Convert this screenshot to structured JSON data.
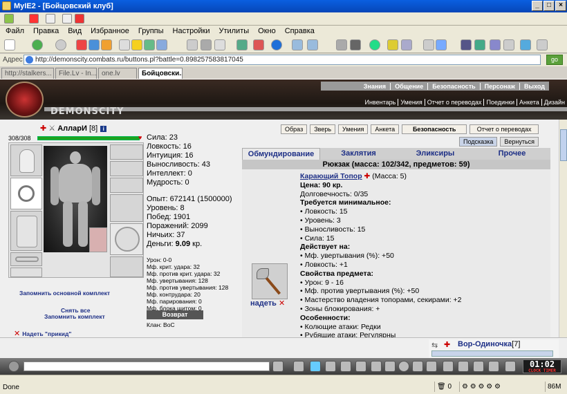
{
  "window": {
    "title": "MyIE2 - [Бойцовский клуб]"
  },
  "menu": [
    "Файл",
    "Правка",
    "Вид",
    "Избранное",
    "Группы",
    "Настройки",
    "Утилиты",
    "Окно",
    "Справка"
  ],
  "address": {
    "label": "Адрес",
    "url": "http://demonscity.combats.ru/buttons.pl?battle=0.898257583817045",
    "go": "go"
  },
  "tabs": [
    "http://stalkers...",
    "File.Lv - In...",
    "one.lv",
    "Бойцовски..."
  ],
  "site": {
    "logo_text": "DEMONSCITY",
    "topnav": [
      "Знания",
      "Общение",
      "Безопасность",
      "Персонаж",
      "Выход"
    ],
    "subnav": [
      "Инвентарь",
      "Умения",
      "Отчет о переводах",
      "Поединки",
      "Анкета",
      "Дизайн"
    ]
  },
  "character": {
    "name": "АлларИ",
    "level": "[8]",
    "hp": "308/308",
    "stats": [
      "Сила: 23",
      "Ловкость: 16",
      "Интуиция: 16",
      "Выносливость: 43",
      "Интеллект: 0",
      "Мудрость: 0"
    ],
    "stats2": [
      "Опыт: 672141 (1500000)",
      "Уровень: 8",
      "Побед: 1901",
      "Поражений: 2099",
      "Ничьих: 37"
    ],
    "money_label": "Деньги:",
    "money_value": "9.09",
    "money_unit": "кр.",
    "mods": [
      "Урон: 0-0",
      "Мф. крит. удара: 32",
      "Мф. против крит. удара: 32",
      "Мф. увертывания: 128",
      "Мф. против увертывания: 128",
      "Мф. контрудара: 20",
      "Мф. парирования: 0",
      "Мф. блока щитом: 0"
    ],
    "return_button": "Возврат",
    "clan": "Клан: ВоС",
    "links": {
      "remember_main": "Запомнить основной комплект",
      "remove_all": "Снять все",
      "remember_set": "Запомнить комплект",
      "wear": "Надеть \"прикид\""
    }
  },
  "buttons": {
    "row1": [
      "Образ",
      "Зверь",
      "Умения",
      "Анкета"
    ],
    "security": "Безопасность",
    "report": "Отчет о переводах",
    "hint": "Подсказка",
    "back": "Вернуться"
  },
  "inventory": {
    "tabs": [
      "Обмундирование",
      "Заклятия",
      "Эликсиры",
      "Прочее"
    ],
    "bag": "Рюкзак (масса: 102/342, предметов: 59)",
    "wear_link": "надеть",
    "item": {
      "name": "Карающий Топор",
      "mass": "(Масса: 5)",
      "price": "Цена: 90 кр.",
      "durability": "Долговечность: 0/35",
      "req_title": "Требуется минимальное:",
      "req": [
        "• Ловкость: 15",
        "• Уровень: 3",
        "• Выносливость: 15",
        "• Сила: 15"
      ],
      "acts_title": "Действует на:",
      "acts": [
        "• Мф. увертывания (%): +50",
        "• Ловкость: +1"
      ],
      "props_title": "Свойства предмета:",
      "props": [
        "• Урон: 9 - 16",
        "• Мф. против увертывания (%): +50",
        "• Мастерство владения топорами, секирами: +2",
        "• Зоны блокирования: +"
      ],
      "feat_title": "Особенности:",
      "feat": [
        "• Колющие атаки: Редки",
        "• Рубящие атаки: Регулярны"
      ]
    }
  },
  "chat": {
    "user": "Вор-Одиночка",
    "user_level": "[7]"
  },
  "clock": {
    "time": "01:02",
    "label": "CLOCK TIMER"
  },
  "status": {
    "done": "Done",
    "count": "0",
    "memory": "86M"
  }
}
